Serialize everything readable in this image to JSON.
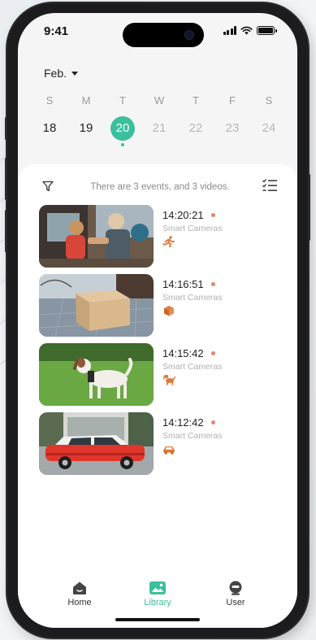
{
  "status": {
    "time": "9:41"
  },
  "calendar": {
    "month": "Feb.",
    "days": [
      {
        "name": "S",
        "num": "18",
        "state": "past"
      },
      {
        "name": "M",
        "num": "19",
        "state": "past"
      },
      {
        "name": "T",
        "num": "20",
        "state": "selected"
      },
      {
        "name": "W",
        "num": "21",
        "state": "future"
      },
      {
        "name": "T",
        "num": "22",
        "state": "future"
      },
      {
        "name": "F",
        "num": "23",
        "state": "future"
      },
      {
        "name": "S",
        "num": "24",
        "state": "future"
      }
    ]
  },
  "events_panel": {
    "summary": "There are 3 events, and 3 videos.",
    "items": [
      {
        "time": "14:20:21",
        "source": "Smart Cameras",
        "type_icon": "person-running-icon"
      },
      {
        "time": "14:16:51",
        "source": "Smart Cameras",
        "type_icon": "package-icon"
      },
      {
        "time": "14:15:42",
        "source": "Smart Cameras",
        "type_icon": "pet-icon"
      },
      {
        "time": "14:12:42",
        "source": "Smart Cameras",
        "type_icon": "car-icon"
      }
    ]
  },
  "tabs": [
    {
      "label": "Home",
      "icon": "home-icon",
      "active": false
    },
    {
      "label": "Library",
      "icon": "image-icon",
      "active": true
    },
    {
      "label": "User",
      "icon": "user-icon",
      "active": false
    }
  ],
  "colors": {
    "accent": "#3bbf9d",
    "event_icon": "#e07a3a",
    "event_dot": "#e08472"
  }
}
